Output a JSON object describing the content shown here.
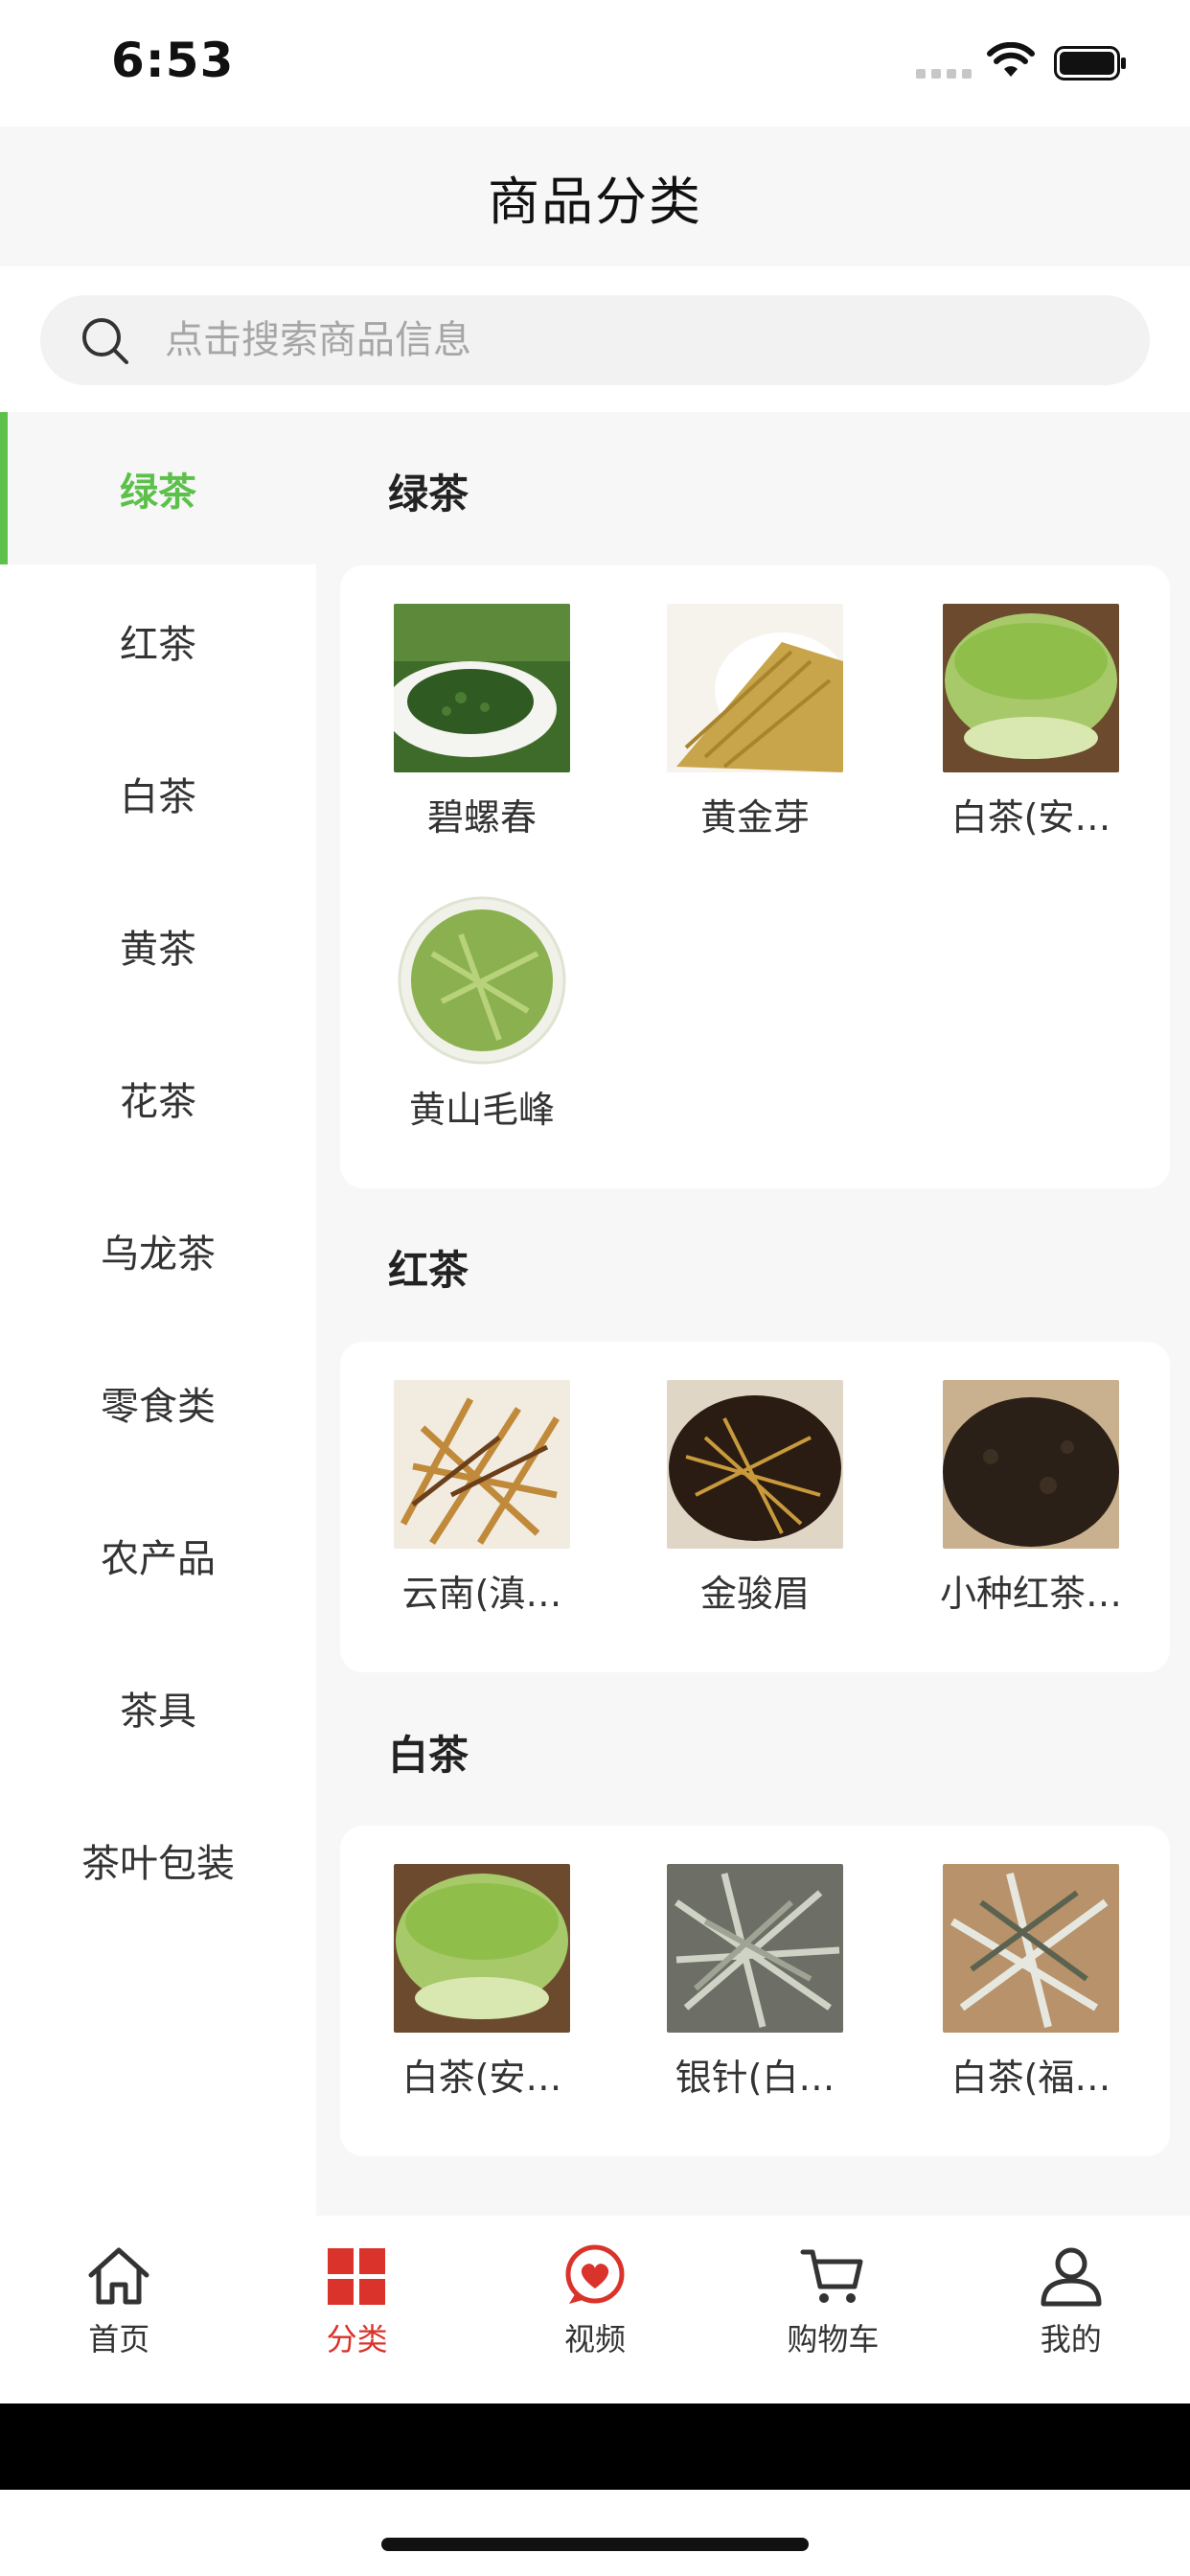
{
  "status_bar": {
    "time": "6:53"
  },
  "header": {
    "title": "商品分类"
  },
  "search": {
    "placeholder": "点击搜索商品信息"
  },
  "sidebar": {
    "items": [
      {
        "label": "绿茶",
        "active": true
      },
      {
        "label": "红茶"
      },
      {
        "label": "白茶"
      },
      {
        "label": "黄茶"
      },
      {
        "label": "花茶"
      },
      {
        "label": "乌龙茶"
      },
      {
        "label": "零食类"
      },
      {
        "label": "农产品"
      },
      {
        "label": "茶具"
      },
      {
        "label": "茶叶包装"
      }
    ]
  },
  "sections": [
    {
      "title": "绿茶",
      "products": [
        {
          "name": "碧螺春"
        },
        {
          "name": "黄金芽"
        },
        {
          "name": "白茶(安…"
        },
        {
          "name": "黄山毛峰"
        }
      ]
    },
    {
      "title": "红茶",
      "products": [
        {
          "name": "云南(滇…"
        },
        {
          "name": "金骏眉"
        },
        {
          "name": "小种红茶…"
        }
      ]
    },
    {
      "title": "白茶",
      "products": [
        {
          "name": "白茶(安…"
        },
        {
          "name": "银针(白…"
        },
        {
          "name": "白茶(福…"
        }
      ]
    }
  ],
  "tab_bar": {
    "tabs": [
      {
        "label": "首页",
        "icon": "home-icon"
      },
      {
        "label": "分类",
        "icon": "category-grid-icon",
        "active": true
      },
      {
        "label": "视频",
        "icon": "video-heart-icon"
      },
      {
        "label": "购物车",
        "icon": "cart-icon"
      },
      {
        "label": "我的",
        "icon": "user-icon"
      }
    ]
  },
  "colors": {
    "accent_green": "#5cc04a",
    "accent_red": "#d9332b",
    "background_gray": "#f7f7f7"
  }
}
